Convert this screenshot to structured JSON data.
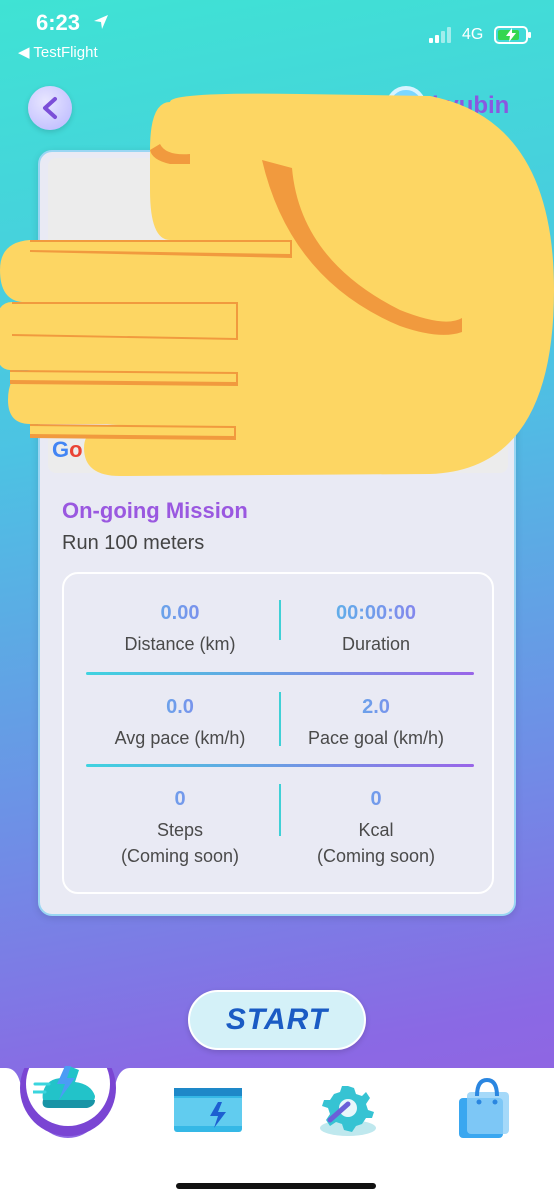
{
  "status_bar": {
    "time": "6:23",
    "back_app": "◀ TestFlight",
    "network": "4G",
    "battery_level": 0.8
  },
  "header": {
    "username": "kyubin"
  },
  "map": {
    "logo_first": "G",
    "logo_second": "o"
  },
  "mission": {
    "title": "On-going Mission",
    "description": "Run 100 meters"
  },
  "stats": {
    "distance": {
      "value": "0.00",
      "label": "Distance (km)"
    },
    "duration": {
      "value": "00:00:00",
      "label": "Duration"
    },
    "avg_pace": {
      "value": "0.0",
      "label": "Avg pace (km/h)"
    },
    "pace_goal": {
      "value": "2.0",
      "label": "Pace goal (km/h)"
    },
    "steps": {
      "value": "0",
      "label_line1": "Steps",
      "label_line2": "(Coming soon)"
    },
    "kcal": {
      "value": "0",
      "label_line1": "Kcal",
      "label_line2": "(Coming soon)"
    }
  },
  "start_button": {
    "label": "START"
  },
  "nav": {
    "items": [
      {
        "icon": "running-shoe-icon"
      },
      {
        "icon": "energy-card-icon"
      },
      {
        "icon": "gear-wrench-icon"
      },
      {
        "icon": "shopping-bag-icon"
      }
    ]
  },
  "colors": {
    "accent_purple": "#9a58e0",
    "accent_cyan": "#3fd0d6",
    "start_text": "#1a5bc4"
  }
}
